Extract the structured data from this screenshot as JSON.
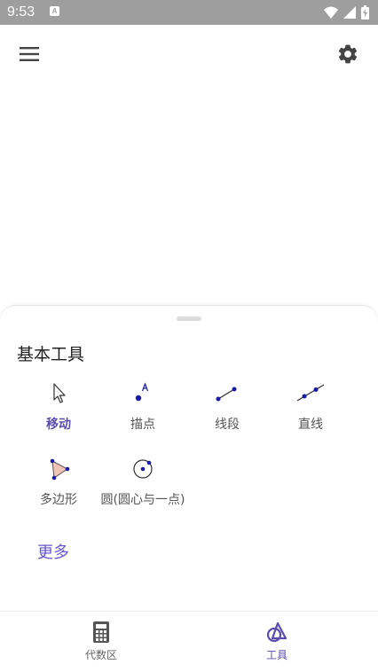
{
  "status_bar": {
    "time": "9:53",
    "notification_letter": "A"
  },
  "toolbar": {
    "menu_icon": "hamburger-menu-icon",
    "settings_icon": "gear-icon"
  },
  "tools_panel": {
    "title": "基本工具",
    "tools": [
      {
        "label": "移动",
        "icon": "move-arrow-icon",
        "active": true
      },
      {
        "label": "描点",
        "icon": "point-icon",
        "active": false
      },
      {
        "label": "线段",
        "icon": "segment-icon",
        "active": false
      },
      {
        "label": "直线",
        "icon": "line-icon",
        "active": false
      },
      {
        "label": "多边形",
        "icon": "polygon-icon",
        "active": false
      },
      {
        "label": "圆(圆心与一点)",
        "icon": "circle-center-point-icon",
        "active": false
      }
    ],
    "more_label": "更多"
  },
  "bottom_nav": {
    "items": [
      {
        "label": "代数区",
        "icon": "calculator-icon",
        "active": false
      },
      {
        "label": "工具",
        "icon": "tools-shapes-icon",
        "active": true
      }
    ]
  },
  "colors": {
    "accent": "#5b4cb0",
    "point": "#1a1aa6",
    "status_bar": "#9e9e9e",
    "polygon_fill": "#f2c4b5"
  }
}
